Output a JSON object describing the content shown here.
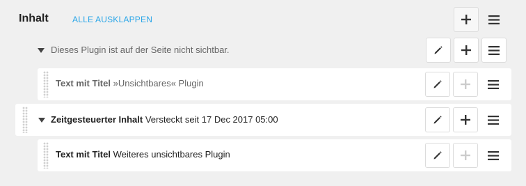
{
  "header": {
    "title": "Inhalt",
    "expand_all_label": "ALLE AUSKLAPPEN"
  },
  "rows": [
    {
      "text": "Dieses Plugin ist auf der Seite nicht sichtbar."
    },
    {
      "title": "Text mit Titel",
      "subtitle": "»Unsichtbares« Plugin"
    },
    {
      "title": "Zeitgesteuerter Inhalt",
      "subtitle": "Versteckt seit 17 Dec 2017 05:00"
    },
    {
      "title": "Text mit Titel",
      "subtitle": "Weiteres unsichtbares Plugin"
    }
  ],
  "icons": {
    "add": "plus-icon",
    "edit": "pencil-icon",
    "menu": "hamburger-menu-icon",
    "drag": "drag-handle-icon",
    "expand": "caret-down-icon"
  },
  "colors": {
    "accent_link": "#2aa6e8",
    "background": "#f0f0f0",
    "row_background": "#ffffff",
    "icon": "#333333",
    "icon_disabled": "#cccccc"
  }
}
